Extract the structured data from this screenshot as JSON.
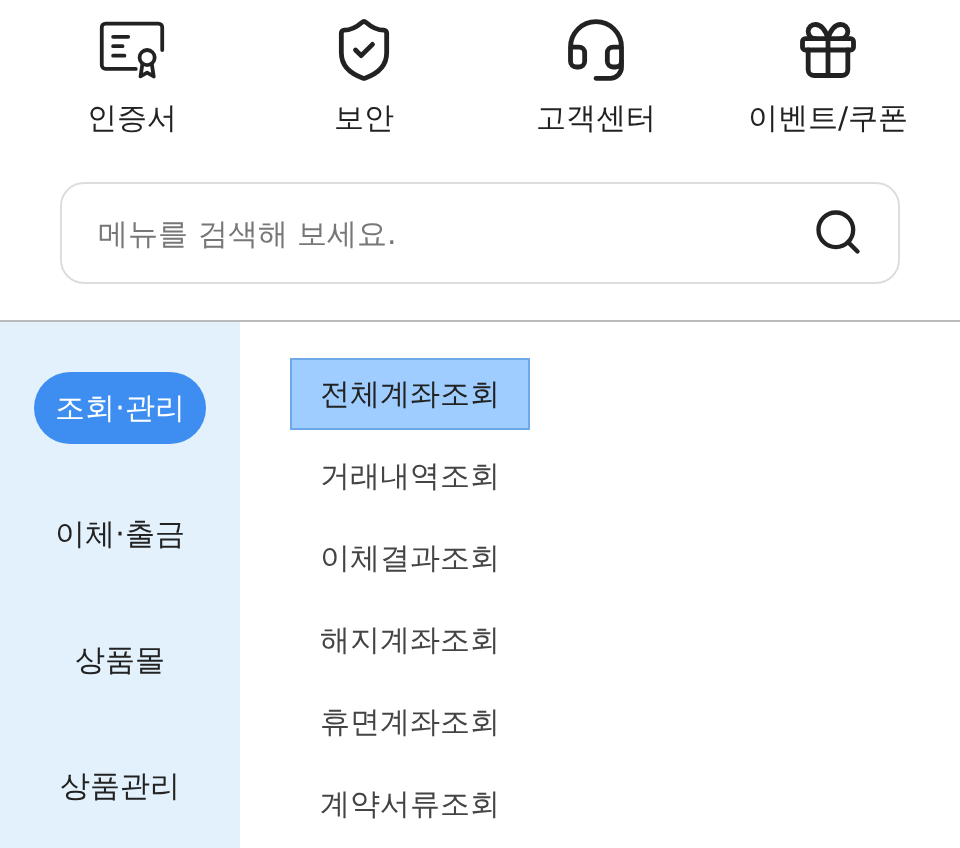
{
  "shortcuts": [
    {
      "label": "인증서",
      "kind": "certificate"
    },
    {
      "label": "보안",
      "kind": "shield"
    },
    {
      "label": "고객센터",
      "kind": "headset"
    },
    {
      "label": "이벤트/쿠폰",
      "kind": "gift"
    }
  ],
  "search": {
    "placeholder": "메뉴를 검색해 보세요."
  },
  "categories": [
    {
      "label": "조회·관리",
      "selected": true
    },
    {
      "label": "이체·출금",
      "selected": false
    },
    {
      "label": "상품몰",
      "selected": false
    },
    {
      "label": "상품관리",
      "selected": false
    }
  ],
  "menu_items": [
    {
      "label": "전체계좌조회",
      "selected": true
    },
    {
      "label": "거래내역조회",
      "selected": false
    },
    {
      "label": "이체결과조회",
      "selected": false
    },
    {
      "label": "해지계좌조회",
      "selected": false
    },
    {
      "label": "휴면계좌조회",
      "selected": false
    },
    {
      "label": "계약서류조회",
      "selected": false
    }
  ]
}
